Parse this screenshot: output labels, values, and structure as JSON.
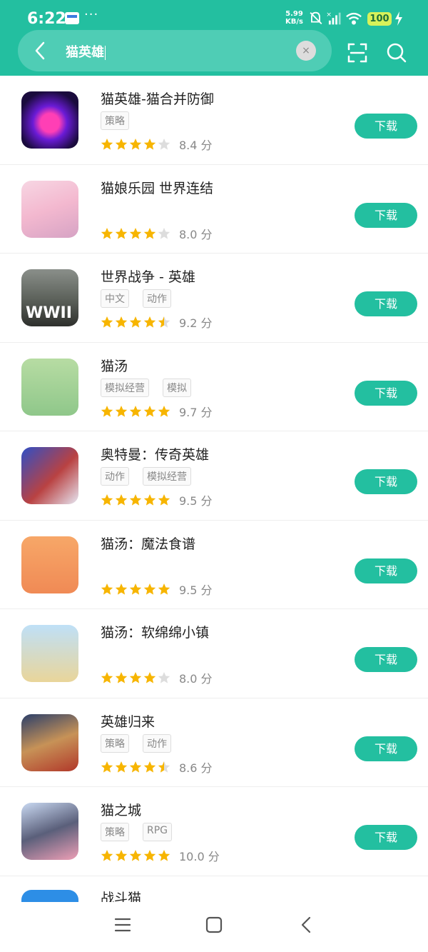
{
  "status_bar": {
    "time": "6:22",
    "net_speed_value": "5.99",
    "net_speed_unit": "KB/s",
    "battery": "100",
    "dots": "···"
  },
  "search": {
    "query": "猫英雄",
    "clear_symbol": "×"
  },
  "colors": {
    "accent": "#23bfa0",
    "star_filled": "#f7b500",
    "star_empty": "#dddddd"
  },
  "download_label": "下载",
  "apps": [
    {
      "name": "猫英雄-猫合并防御",
      "tags": [
        "策略"
      ],
      "stars": 4,
      "score": "8.4 分",
      "icon": "purple-cat-icon"
    },
    {
      "name": "猫娘乐园 世界连结",
      "tags": [],
      "stars": 4,
      "score": "8.0 分",
      "icon": "catgirl-icon"
    },
    {
      "name": "世界战争 - 英雄",
      "tags": [
        "中文",
        "动作"
      ],
      "stars": 4.5,
      "score": "9.2 分",
      "icon": "soldier-icon",
      "icon_text": "WWII"
    },
    {
      "name": "猫汤",
      "tags": [
        "模拟经营",
        "模拟"
      ],
      "stars": 5,
      "score": "9.7 分",
      "icon": "frog-cat-icon"
    },
    {
      "name": "奥特曼：传奇英雄",
      "tags": [
        "动作",
        "模拟经营"
      ],
      "stars": 5,
      "score": "9.5 分",
      "icon": "ultraman-icon"
    },
    {
      "name": "猫汤：魔法食谱",
      "tags": [],
      "stars": 5,
      "score": "9.5 分",
      "icon": "wizard-cat-icon"
    },
    {
      "name": "猫汤：软绵绵小镇",
      "tags": [],
      "stars": 4,
      "score": "8.0 分",
      "icon": "farmer-cat-icon"
    },
    {
      "name": "英雄归来",
      "tags": [
        "策略",
        "动作"
      ],
      "stars": 4.5,
      "score": "8.6 分",
      "icon": "thor-icon"
    },
    {
      "name": "猫之城",
      "tags": [
        "策略",
        "RPG"
      ],
      "stars": 5,
      "score": "10.0 分",
      "icon": "anime-girl-icon"
    }
  ],
  "partial_app": {
    "name": "战斗猫"
  }
}
